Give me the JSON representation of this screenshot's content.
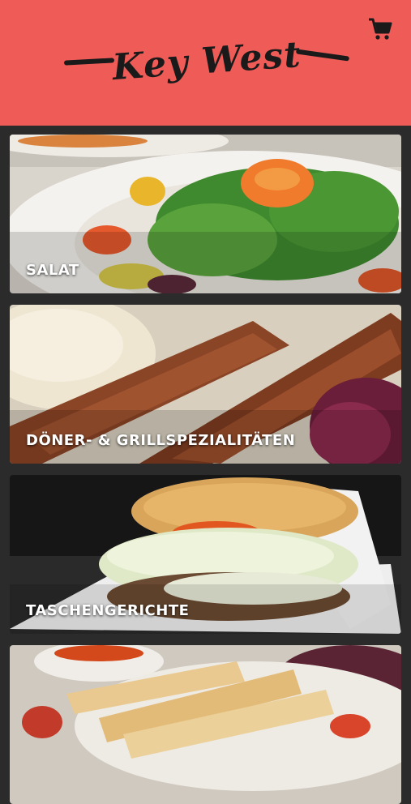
{
  "app": {
    "logo_text": "Key West",
    "brand_color": "#ef5b57",
    "cart_icon": "shopping-cart-icon"
  },
  "categories": [
    {
      "label": "SALAT"
    },
    {
      "label": "DÖNER- & GRILLSPEZIALITÄTEN"
    },
    {
      "label": "TASCHENGERICHTE"
    },
    {
      "label": ""
    }
  ]
}
